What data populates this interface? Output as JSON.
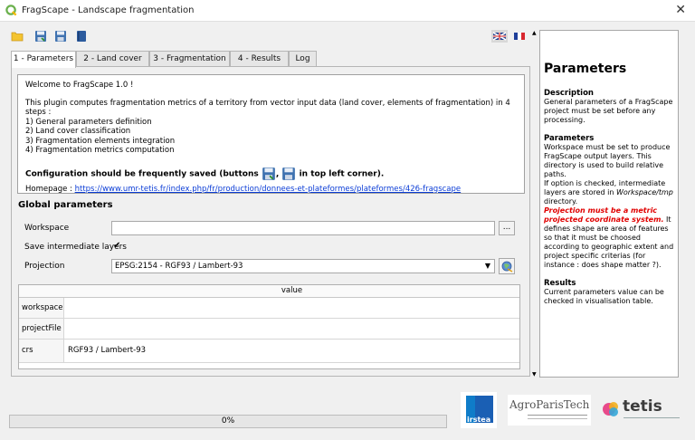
{
  "window": {
    "title": "FragScape - Landscape fragmentation"
  },
  "tabs": [
    {
      "label": "1 - Parameters"
    },
    {
      "label": "2 - Land cover"
    },
    {
      "label": "3 - Fragmentation"
    },
    {
      "label": "4 - Results"
    },
    {
      "label": "Log"
    }
  ],
  "intro": {
    "welcome": "Welcome to FragScape 1.0 !",
    "description": "This plugin computes fragmentation metrics of a territory from vector input data (land cover, elements of fragmentation) in 4 steps :",
    "steps": [
      "1) General parameters definition",
      "2) Land cover classification",
      "3) Fragmentation elements integration",
      "4) Fragmentation metrics computation"
    ],
    "save_note_a": "Configuration should be frequently saved (buttons",
    "save_note_b": ",",
    "save_note_c": "in top left corner).",
    "homepage_label": "Homepage : ",
    "homepage_url": "https://www.umr-tetis.fr/index.php/fr/production/donnees-et-plateformes/plateformes/426-fragscape"
  },
  "global": {
    "title": "Global parameters",
    "workspace_label": "Workspace",
    "workspace_value": "",
    "browse_label": "...",
    "save_layers_label": "Save intermediate layers",
    "save_layers_checked": true,
    "projection_label": "Projection",
    "projection_value": "EPSG:2154 - RGF93 / Lambert-93"
  },
  "table": {
    "header": "value",
    "rows": [
      {
        "key": "workspace",
        "value": ""
      },
      {
        "key": "projectFile",
        "value": ""
      },
      {
        "key": "crs",
        "value": "RGF93 / Lambert-93"
      }
    ]
  },
  "help": {
    "title": "Parameters",
    "desc_h": "Description",
    "desc_p": " General parameters of a FragScape project must be set before any processing.",
    "params_h": "Parameters",
    "params_p1": " Workspace must be set to produce FragScape output layers. This directory is used to build relative paths.",
    "params_p2a": " If option is checked, intermediate layers are stored in ",
    "params_p2b": "Workspace/tmp",
    "params_p2c": " directory.",
    "params_p3a": " Projection must be a metric projected coordinate system.",
    "params_p3b": " It defines shape are area of features so that it must be choosed according to geographic extent and project specific criterias (for instance : does shape matter ?).",
    "results_h": "Results",
    "results_p": " Current parameters value can be checked in visualisation table."
  },
  "progress": {
    "label": "0%",
    "value": 0
  },
  "logos": {
    "irstea": "irstea",
    "agro": "AgroParisTech",
    "tetis": "tetis"
  },
  "colors": {
    "irstea_blue": "#1a5fb4",
    "link": "#0a3cd6",
    "warning": "#e00000",
    "qgis_green": "#6ab04c"
  }
}
